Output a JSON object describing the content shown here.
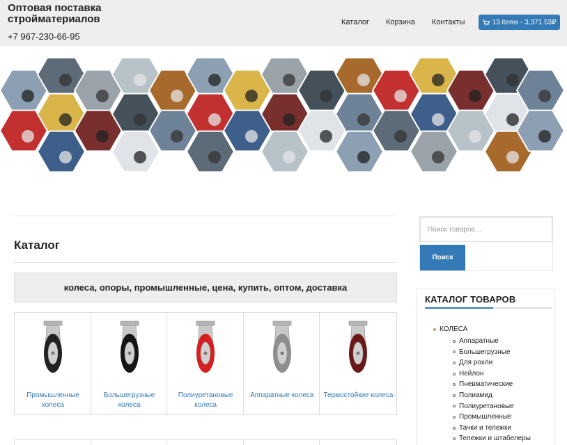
{
  "header": {
    "brand": "Оптовая поставка стройматериалов",
    "phone": "+7 967-230-66-95",
    "nav": [
      "Каталог",
      "Корзина",
      "Контакты"
    ],
    "cart_label": "13 items - 3,371.53₽"
  },
  "main": {
    "title": "Каталог",
    "keywords": "колеса, опоры, промышленные, цена, купить, оптом, доставка",
    "categories": [
      {
        "label": "Промышленные колеса",
        "wheel_color": "#222222"
      },
      {
        "label": "Большегрузные колеса",
        "wheel_color": "#151515"
      },
      {
        "label": "Полиуретановые колеса",
        "wheel_color": "#d42020"
      },
      {
        "label": "Аппаратные колеса",
        "wheel_color": "#8e8e8e"
      },
      {
        "label": "Термостойкие колеса",
        "wheel_color": "#6b1818"
      }
    ]
  },
  "sidebar": {
    "search_placeholder": "Поиск товаров…",
    "search_button": "Поиск",
    "catalog_title": "КАТАЛОГ ТОВАРОВ",
    "root_category": "КОЛЕСА",
    "subcategories": [
      "Аппаратные",
      "Большегрузные",
      "Для рохли",
      "Нейлон",
      "Пневматические",
      "Полиамид",
      "Полиуретановые",
      "Промышленные",
      "Тачки и тележки",
      "Тележки и штабелеры"
    ]
  },
  "colors": {
    "accent": "#337ab7",
    "header_bg": "#eeeeee"
  }
}
